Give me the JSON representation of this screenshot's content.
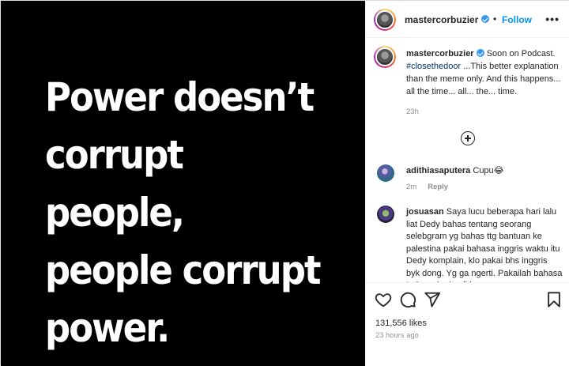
{
  "post": {
    "quote_lines": [
      "Power doesn’t",
      "corrupt people,",
      "people corrupt",
      "power."
    ]
  },
  "header": {
    "username": "mastercorbuzier",
    "separator": "•",
    "follow_label": "Follow",
    "more_label": "•••"
  },
  "caption": {
    "username": "mastercorbuzier",
    "text_before": " Soon on Podcast. ",
    "hashtag": "#closethedoor",
    "text_after": " ...This better explanation than the meme only. And this happens... all the time... all... the... time.",
    "age": "23h"
  },
  "comments": [
    {
      "username": "adithiasaputera",
      "text": " Cupu😂",
      "age": "2m",
      "reply_label": "Reply"
    },
    {
      "username": "josuasan",
      "text": " Saya lucu beberapa hari lalu liat Dedy bahas tentang seorang selebgram yg bahas ttg bantuan ke palestina pakai bahasa inggris waktu itu Dedy komplain, klo pakai bhs inggris byk dong. Yg ga ngerti. Pakailah bahasa Indonesia demikian"
    }
  ],
  "actions": {
    "icons": [
      "heart-icon",
      "comment-icon",
      "share-icon",
      "bookmark-icon"
    ],
    "likes": "131,556 likes",
    "timestamp": "23 hours ago"
  }
}
